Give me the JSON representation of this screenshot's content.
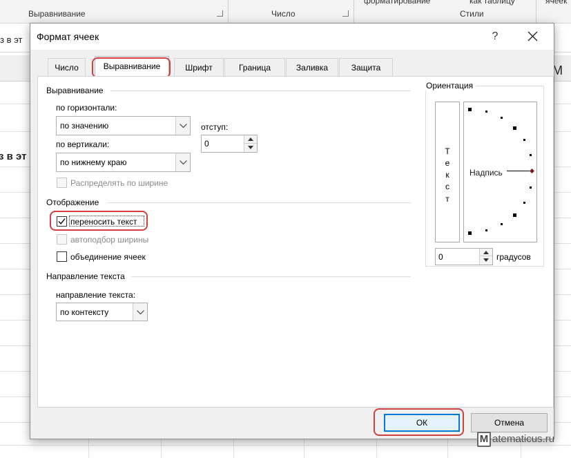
{
  "background": {
    "ribbon": {
      "group_alignment": "Выравнивание",
      "group_number": "Число",
      "group_styles": "Стили",
      "cut_top_1": "форматирование",
      "cut_top_2": "как таблицу",
      "cut_top_3": "ячеек"
    },
    "formula_fragment": "з в эт",
    "cell_fragment": "з в эт",
    "col_fragment": "М"
  },
  "dialog": {
    "title": "Формат ячеек",
    "help_glyph": "?",
    "tabs": [
      {
        "label": "Число"
      },
      {
        "label": "Выравнивание"
      },
      {
        "label": "Шрифт"
      },
      {
        "label": "Граница"
      },
      {
        "label": "Заливка"
      },
      {
        "label": "Защита"
      }
    ],
    "active_tab": "Выравнивание",
    "alignment": {
      "section": "Выравнивание",
      "horizontal_label": "по горизонтали:",
      "horizontal_value": "по значению",
      "indent_label": "отступ:",
      "indent_value": "0",
      "vertical_label": "по вертикали:",
      "vertical_value": "по нижнему краю",
      "distribute_label": "Распределять по ширине",
      "distribute_checked": false
    },
    "display": {
      "section": "Отображение",
      "wrap_label": "переносить текст",
      "wrap_checked": true,
      "shrink_label": "автоподбор ширины",
      "shrink_checked": false,
      "merge_label": "объединение ячеек",
      "merge_checked": false
    },
    "direction": {
      "section": "Направление текста",
      "label": "направление текста:",
      "value": "по контексту"
    },
    "orientation": {
      "section": "Ориентация",
      "vertical_letters": [
        "Т",
        "е",
        "к",
        "с",
        "т"
      ],
      "dial_label": "Надпись",
      "degrees_value": "0",
      "degrees_label": "градусов"
    },
    "buttons": {
      "ok": "ОК",
      "cancel": "Отмена"
    }
  },
  "watermark": {
    "letter": "M",
    "text": "atematicus.ru"
  },
  "colors": {
    "highlight": "#d23f3f",
    "ok_border": "#0078d7",
    "dial_marker": "#8b1a1a"
  }
}
